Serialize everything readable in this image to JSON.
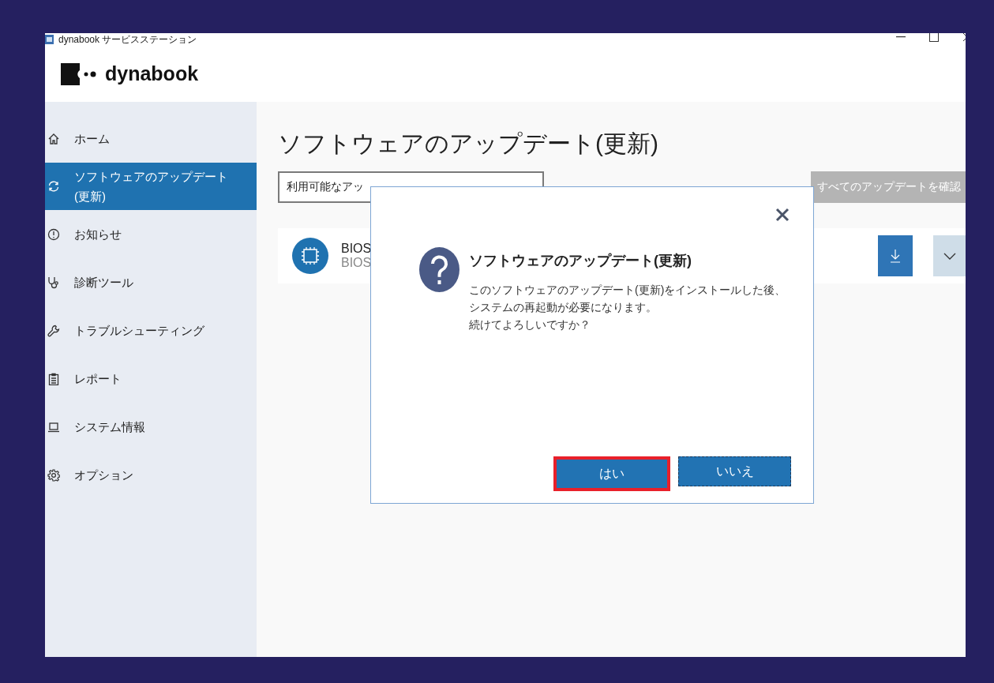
{
  "window": {
    "title": "dynabook サービスステーション"
  },
  "logo": {
    "text": "dynabook"
  },
  "sidebar": {
    "items": [
      {
        "label": "ホーム",
        "selected": false
      },
      {
        "label": "ソフトウェアのアップデート(更新)",
        "selected": true
      },
      {
        "label": "お知らせ",
        "selected": false
      },
      {
        "label": "診断ツール",
        "selected": false
      },
      {
        "label": "トラブルシューティング",
        "selected": false
      },
      {
        "label": "レポート",
        "selected": false
      },
      {
        "label": "システム情報",
        "selected": false
      },
      {
        "label": "オプション",
        "selected": false
      }
    ]
  },
  "main": {
    "title": "ソフトウェアのアップデート(更新)",
    "filter": {
      "value": "利用可能なアッ"
    },
    "check_all_button": "すべてのアップデートを確認",
    "updates": [
      {
        "name": "BIOS",
        "subtitle": "BIOS"
      }
    ]
  },
  "dialog": {
    "title": "ソフトウェアのアップデート(更新)",
    "message": [
      "このソフトウェアのアップデート(更新)をインストールした後、",
      "システムの再起動が必要になります。",
      "続けてよろしいですか？"
    ],
    "buttons": [
      {
        "label": "はい",
        "highlighted": true,
        "focused": false
      },
      {
        "label": "いいえ",
        "highlighted": false,
        "focused": true
      }
    ]
  }
}
